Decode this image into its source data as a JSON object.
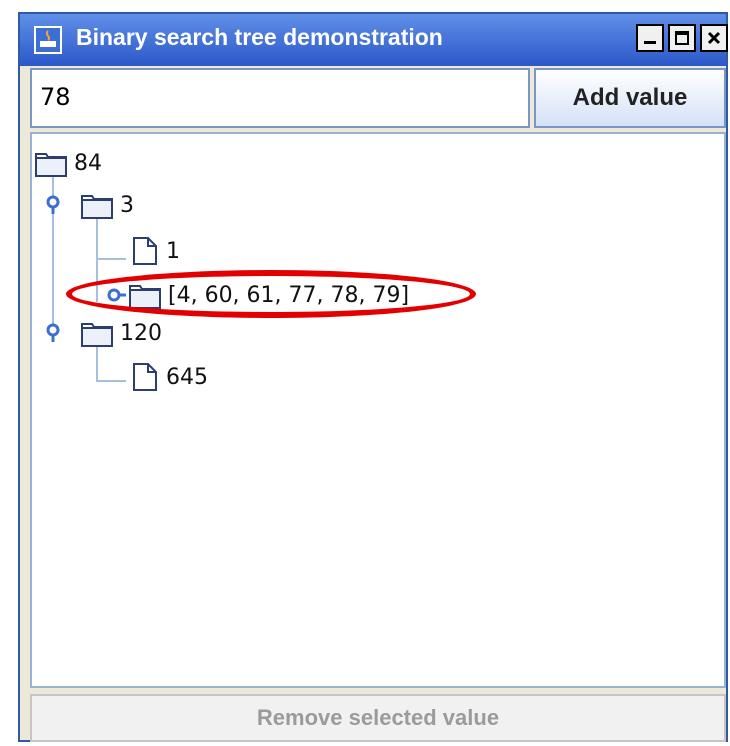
{
  "window": {
    "title": "Binary search tree demonstration",
    "controls": {
      "minimize": "minimize-icon",
      "maximize": "maximize-icon",
      "close": "close-icon"
    }
  },
  "input": {
    "value": "78"
  },
  "buttons": {
    "add": "Add value",
    "remove": "Remove selected value",
    "remove_enabled": false
  },
  "tree": {
    "root": "84",
    "child_3": "3",
    "leaf_1": "1",
    "highlighted": "[4, 60, 61, 77, 78, 79]",
    "child_120": "120",
    "leaf_645": "645"
  },
  "colors": {
    "title_bar": "#2c58c8",
    "highlight": "#e30000"
  }
}
